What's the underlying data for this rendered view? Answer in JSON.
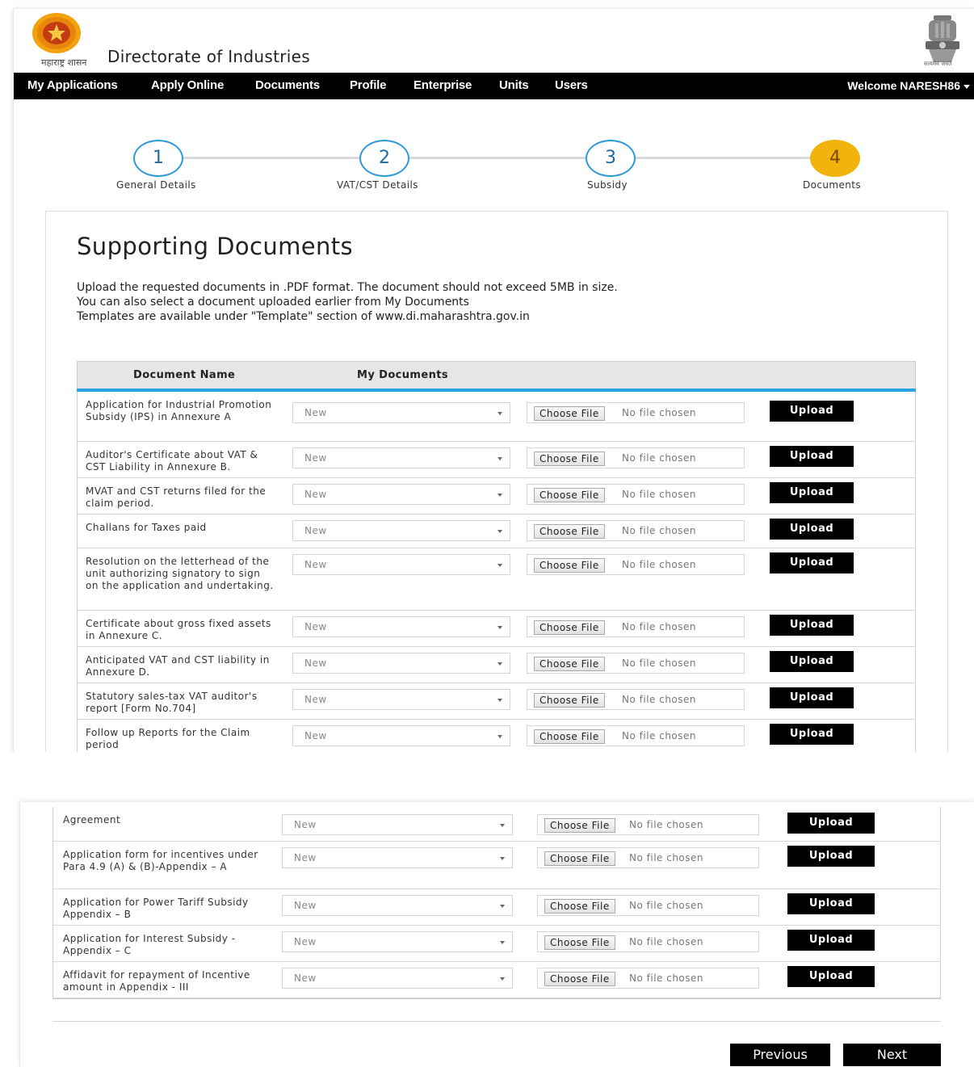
{
  "header": {
    "logo_text": "महाराष्ट्र शासन",
    "title": "Directorate of Industries",
    "emblem_text": "सत्यमेव जयते"
  },
  "nav": {
    "items": [
      "My Applications",
      "Apply Online",
      "Documents",
      "Profile",
      "Enterprise",
      "Units",
      "Users"
    ],
    "welcome": "Welcome NARESH86"
  },
  "stepper": {
    "steps": [
      {
        "number": "1",
        "label": "General Details",
        "active": false
      },
      {
        "number": "2",
        "label": "VAT/CST Details",
        "active": false
      },
      {
        "number": "3",
        "label": "Subsidy",
        "active": false
      },
      {
        "number": "4",
        "label": "Documents",
        "active": true
      }
    ]
  },
  "section": {
    "title": "Supporting Documents",
    "intro": [
      "Upload the requested documents in .PDF format. The document should not exceed 5MB in size.",
      "You can also select a document uploaded earlier from My Documents",
      "Templates are available under \"Template\" section of www.di.maharashtra.gov.in"
    ]
  },
  "table": {
    "headers": {
      "document_name": "Document Name",
      "my_documents": "My Documents"
    },
    "select_value": "New",
    "choose_file_label": "Choose File",
    "no_file_text": "No file chosen",
    "upload_label": "Upload",
    "rows_part1": [
      "Application for Industrial Promotion Subsidy (IPS) in Annexure A",
      "Auditor's Certificate about VAT & CST Liability in Annexure B.",
      "MVAT and CST returns filed for the claim period.",
      "Challans for Taxes paid",
      "Resolution on the letterhead of the unit authorizing signatory to sign on the application and undertaking.",
      "Certificate about gross fixed assets in Annexure C.",
      "Anticipated VAT and CST liability in Annexure D.",
      "Statutory sales-tax VAT auditor's report [Form No.704]",
      "Follow up Reports for the Claim period"
    ],
    "rows_part2": [
      "Agreement",
      "Application form for incentives under Para 4.9 (A) & (B)-Appendix – A",
      "Application for Power Tariff Subsidy Appendix – B",
      "Application for Interest Subsidy - Appendix – C",
      "Affidavit for repayment of Incentive amount in Appendix - III"
    ]
  },
  "footer": {
    "previous_label": "Previous",
    "next_label": "Next"
  },
  "colors": {
    "navbar": "#000000",
    "step_border": "#2a9ad8",
    "step_active": "#f0b40c",
    "table_header_accent": "#2aa2e6"
  }
}
